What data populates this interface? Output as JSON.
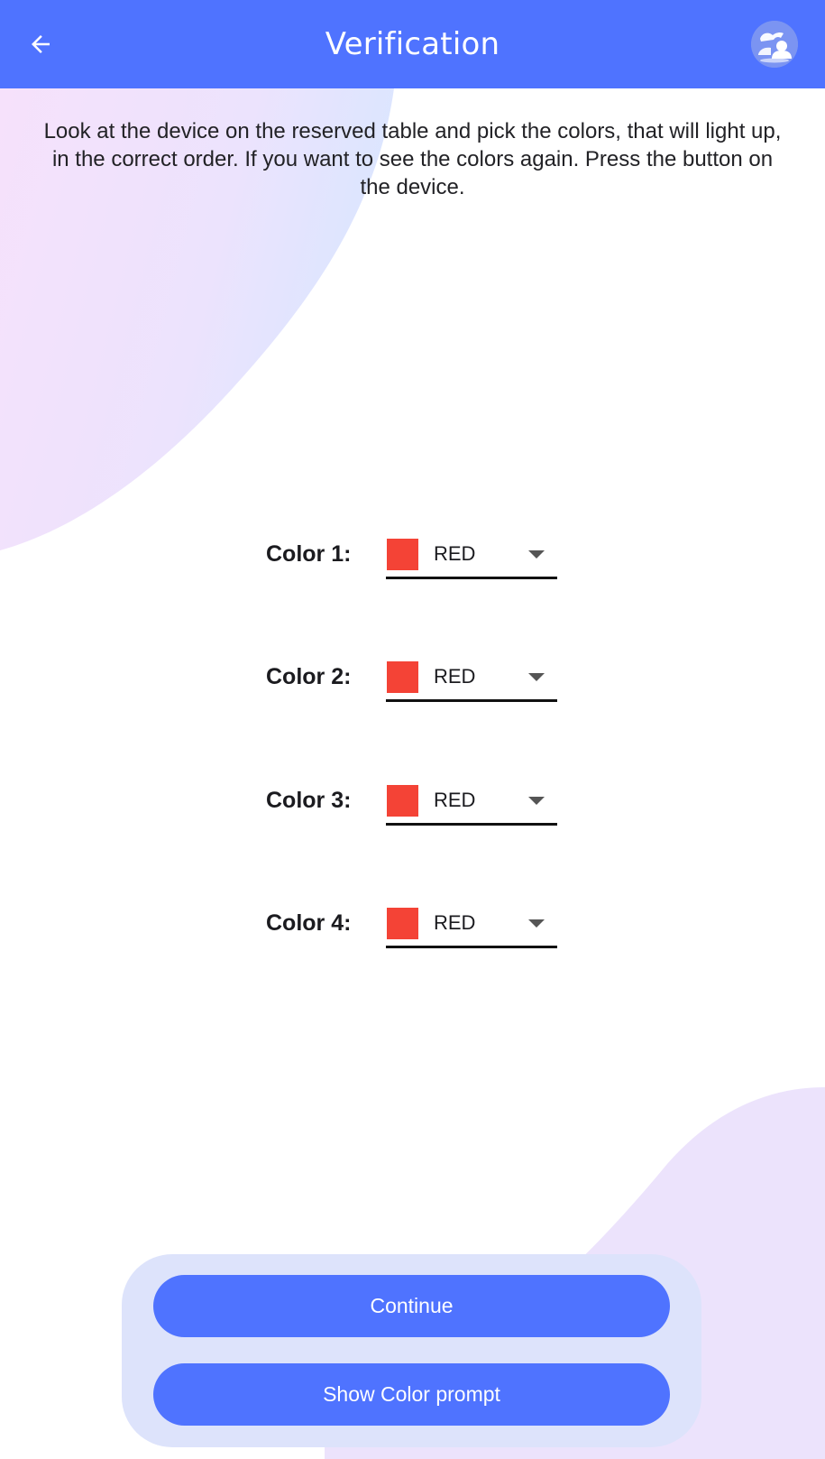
{
  "app_bar": {
    "title": "Verification",
    "back_icon": "arrow-left-icon",
    "avatar_icon": "user-avatar-icon",
    "background": "#4f73ff"
  },
  "instructions": "Look at the device on the reserved table and pick the colors, that will light up, in the correct order. If you want to see the colors again. Press the button on the device.",
  "colors": [
    {
      "label": "Color 1:",
      "value": "RED",
      "swatch": "#f44336"
    },
    {
      "label": "Color 2:",
      "value": "RED",
      "swatch": "#f44336"
    },
    {
      "label": "Color 3:",
      "value": "RED",
      "swatch": "#f44336"
    },
    {
      "label": "Color 4:",
      "value": "RED",
      "swatch": "#f44336"
    }
  ],
  "buttons": {
    "continue_label": "Continue",
    "show_prompt_label": "Show Color prompt"
  },
  "theme": {
    "accent": "#4f73ff",
    "panel": "#dde3fb",
    "blob_pink": "#f6e0fb",
    "blob_lavender": "#ebe3fc"
  }
}
